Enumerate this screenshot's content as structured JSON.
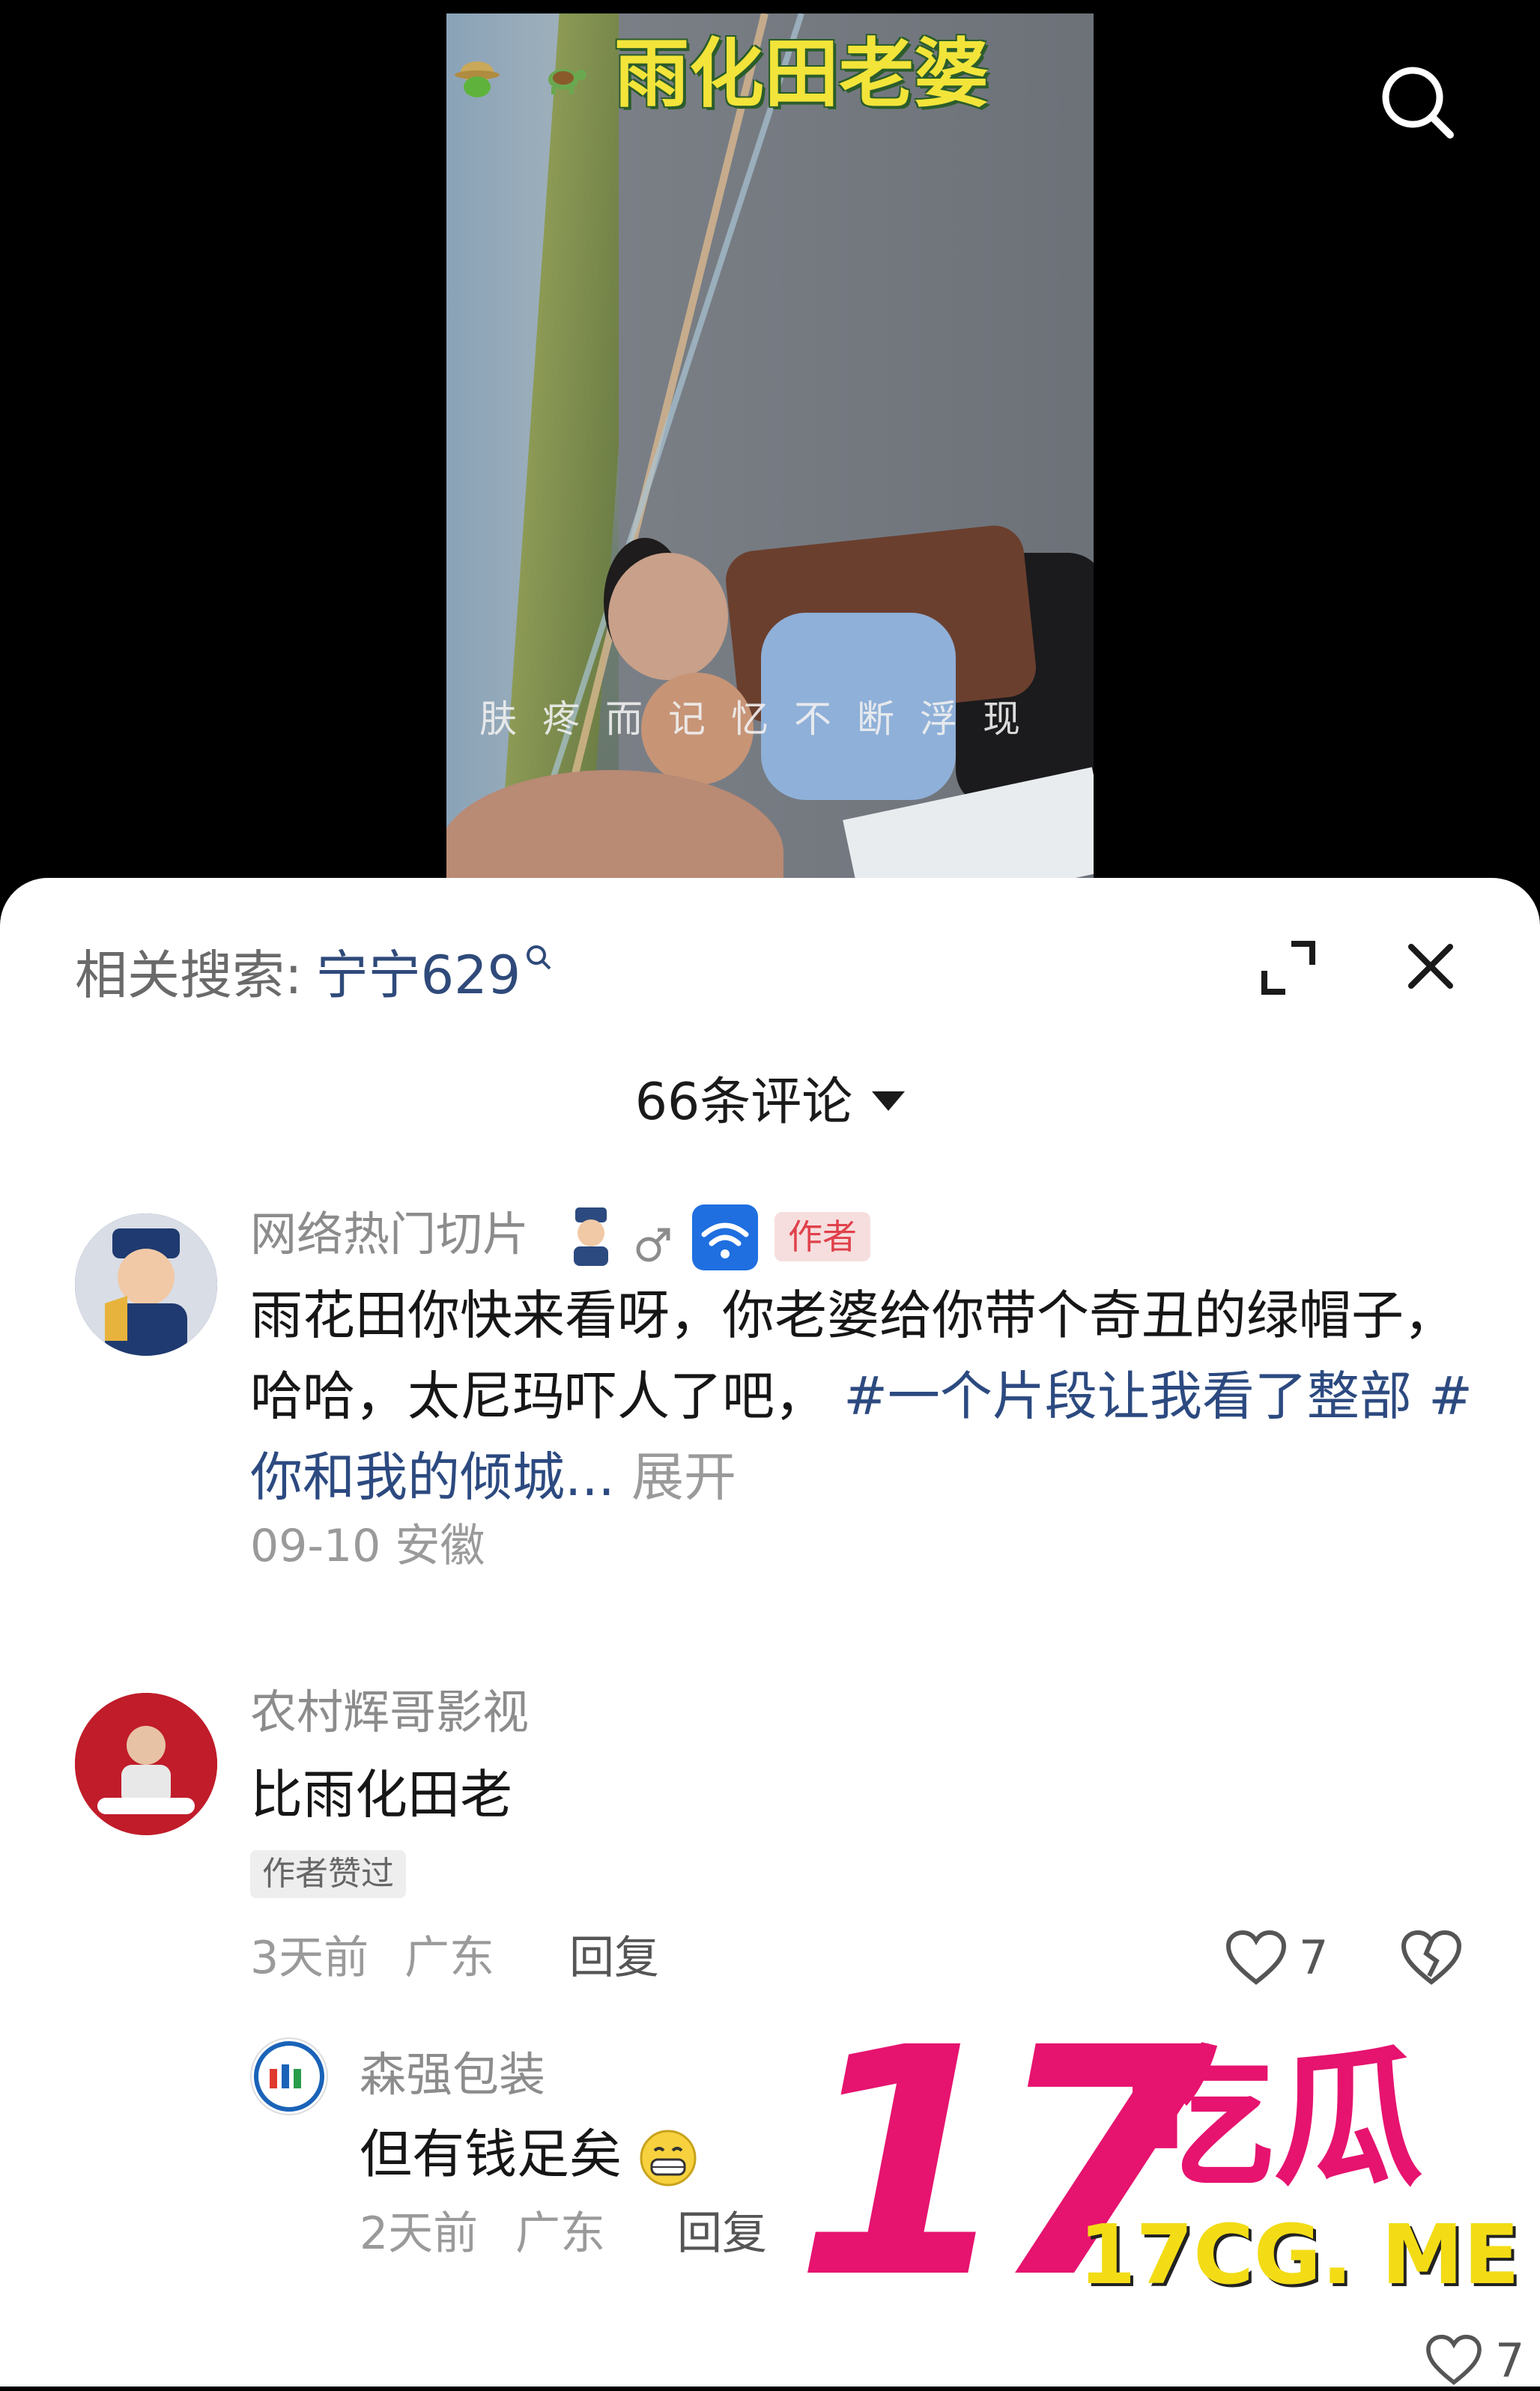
{
  "video": {
    "title": "雨化田老婆",
    "subtitle": "肤疼而记忆不断浮现"
  },
  "panel": {
    "related_label": "相关搜索:",
    "related_term": "宁宁629",
    "comment_count": "66条评论"
  },
  "comments": [
    {
      "user": "网络热门切片",
      "author_badge": "作者",
      "text_plain": "雨花田你快来看呀，你老婆给你带个奇丑的绿帽子，哈哈，太尼玛吓人了吧，",
      "tag1": "#一个片段让我看了整部",
      "tag2": "#你和我的倾城...",
      "expand": "展开",
      "meta": "09-10 安徽"
    },
    {
      "user": "农村辉哥影视",
      "text": "比雨化田老",
      "liked_badge": "作者赞过",
      "meta_time": "3天前",
      "meta_loc": "广东",
      "reply": "回复",
      "like_count": "7"
    },
    {
      "user": "森强包装",
      "text": "但有钱足矣",
      "meta_time": "2天前",
      "meta_loc": "广东",
      "reply": "回复",
      "like_count": "7"
    }
  ],
  "watermark": {
    "number": "17",
    "brand": "吃瓜",
    "url": "17CG. ME"
  },
  "colors": {
    "title_yellow": "#f3e43a",
    "tag_blue": "#2c4a80",
    "author_red": "#e0414b",
    "watermark_pink": "#e6136f",
    "watermark_yellow": "#f3dc16"
  }
}
